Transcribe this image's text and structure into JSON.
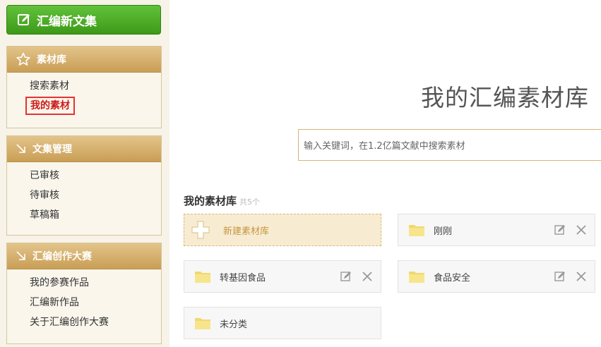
{
  "sidebar": {
    "new_button": "汇编新文集",
    "panels": [
      {
        "title": "素材库",
        "items": [
          "搜索素材",
          "我的素材"
        ]
      },
      {
        "title": "文集管理",
        "items": [
          "已审核",
          "待审核",
          "草稿箱"
        ]
      },
      {
        "title": "汇编创作大赛",
        "items": [
          "我的参赛作品",
          "汇编新作品",
          "关于汇编创作大赛"
        ]
      }
    ]
  },
  "main": {
    "title": "我的汇编素材库",
    "search_placeholder": "输入关键词，在1.2亿篇文献中搜索素材",
    "section_title": "我的素材库",
    "section_count": "共5个",
    "new_library": "新建素材库",
    "folders": [
      "刚刚",
      "转基因食品",
      "食品安全",
      "未分类"
    ]
  },
  "colors": {
    "accent_green": "#4caf2a",
    "panel_header": "#d0a860",
    "active_red": "#e63232"
  }
}
